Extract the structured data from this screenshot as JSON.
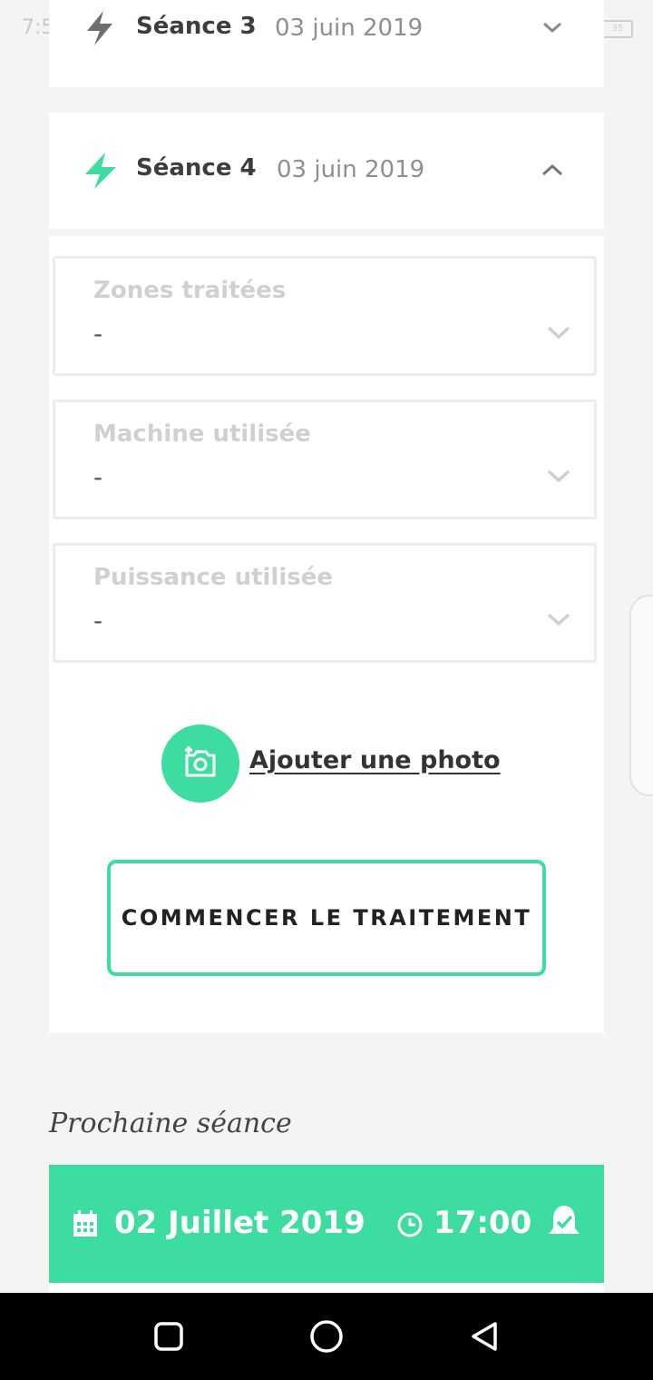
{
  "status": {
    "time": "7:5",
    "battery": "35"
  },
  "sessions": [
    {
      "title": "Séance 3",
      "date": "03 juin 2019",
      "state": "collapsed",
      "icon": "lightning-icon-gray"
    },
    {
      "title": "Séance 4",
      "date": "03 juin 2019",
      "state": "expanded",
      "icon": "lightning-icon-green"
    }
  ],
  "fields": [
    {
      "label": "Zones traitées",
      "value": "-"
    },
    {
      "label": "Machine utilisée",
      "value": "-"
    },
    {
      "label": "Puissance utilisée",
      "value": "-"
    }
  ],
  "photo": {
    "label": "Ajouter une photo",
    "icon": "add-photo-icon"
  },
  "start_button": {
    "label": "COMMENCER LE TRAITEMENT"
  },
  "next": {
    "title": "Prochaine séance",
    "date": "02 Juillet 2019",
    "time": "17:00",
    "icons": [
      "calendar-icon",
      "clock-icon",
      "bell-check-icon"
    ]
  },
  "colors": {
    "accent": "#3ddca0",
    "background": "#f4f4f4",
    "card": "#ffffff"
  }
}
